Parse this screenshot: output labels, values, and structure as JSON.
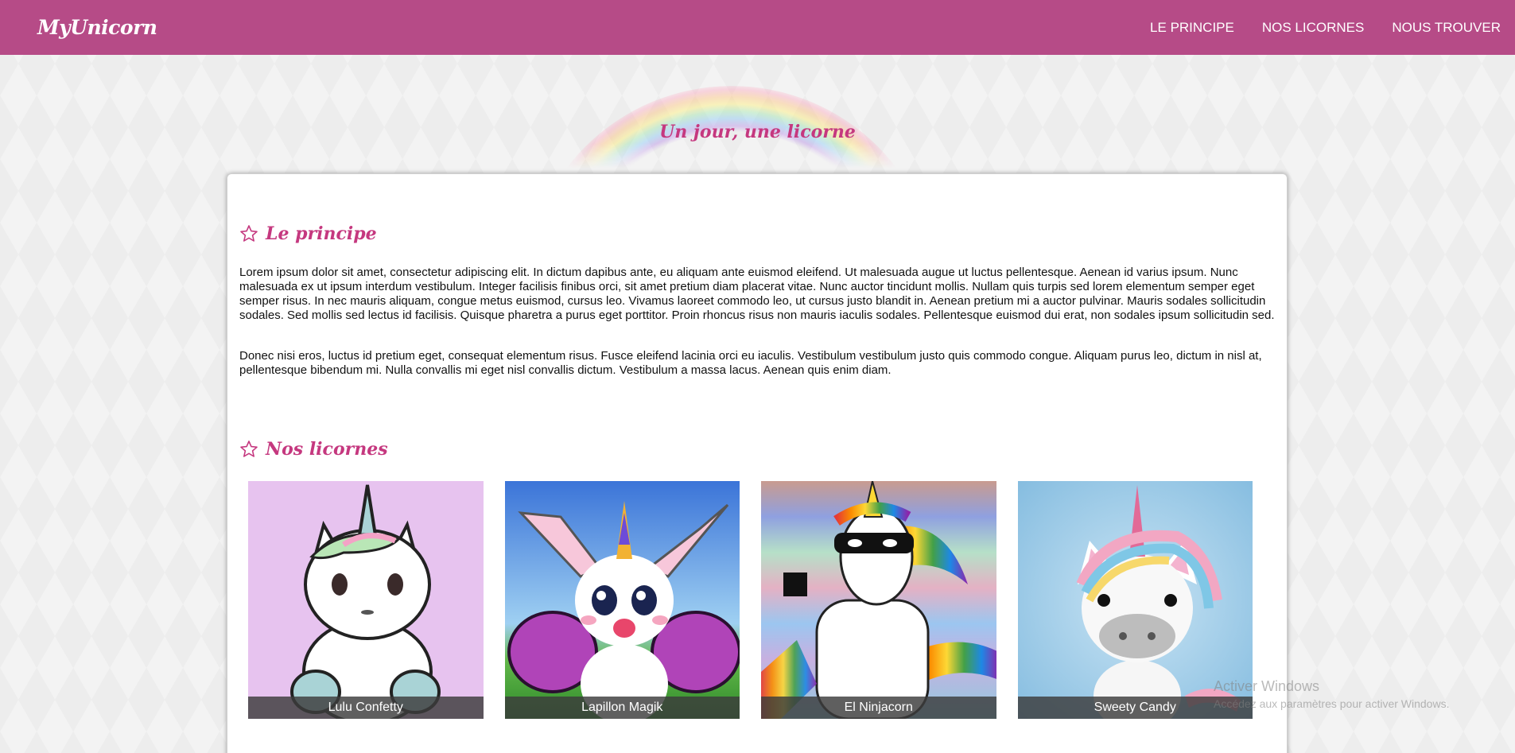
{
  "navbar": {
    "brand": "MyUnicorn",
    "links": [
      "LE PRINCIPE",
      "NOS LICORNES",
      "NOUS TROUVER"
    ]
  },
  "hero": {
    "tagline": "Un jour, une licorne"
  },
  "principle": {
    "title": "Le principe",
    "paragraphs": [
      "Lorem ipsum dolor sit amet, consectetur adipiscing elit. In dictum dapibus ante, eu aliquam ante euismod eleifend. Ut malesuada augue ut luctus pellentesque. Aenean id varius ipsum. Nunc malesuada ex ut ipsum interdum vestibulum. Integer facilisis finibus orci, sit amet pretium diam placerat vitae. Nunc auctor tincidunt mollis. Nullam quis turpis sed lorem elementum semper eget semper risus. In nec mauris aliquam, congue metus euismod, cursus leo. Vivamus laoreet commodo leo, ut cursus justo blandit in. Aenean pretium mi a auctor pulvinar. Mauris sodales sollicitudin sodales. Sed mollis sed lectus id facilisis. Quisque pharetra a purus eget porttitor. Proin rhoncus risus non mauris iaculis sodales. Pellentesque euismod dui erat, non sodales ipsum sollicitudin sed.",
      "Donec nisi eros, luctus id pretium eget, consequat elementum risus. Fusce eleifend lacinia orci eu iaculis. Vestibulum vestibulum justo quis commodo congue. Aliquam purus leo, dictum in nisl at, pellentesque bibendum mi. Nulla convallis mi eget nisl convallis dictum. Vestibulum a massa lacus. Aenean quis enim diam."
    ]
  },
  "unicorns": {
    "title": "Nos licornes",
    "items": [
      {
        "name": "Lulu Confetty",
        "image": "cartoon-unicorn-image"
      },
      {
        "name": "Lapillon Magik",
        "image": "butterfly-unicorn-image"
      },
      {
        "name": "El Ninjacorn",
        "image": "masked-unicorn-image"
      },
      {
        "name": "Sweety Candy",
        "image": "clay-unicorn-image"
      }
    ]
  },
  "watermark": {
    "title": "Activer Windows",
    "subtitle": "Accédez aux paramètres pour activer Windows."
  },
  "colors": {
    "navbar": "#b64b87",
    "accent": "#c5387f",
    "caption_bg": "#3c3c3c",
    "card_bg": "#ffffff"
  },
  "icons": {
    "section": "star-outline-icon"
  }
}
